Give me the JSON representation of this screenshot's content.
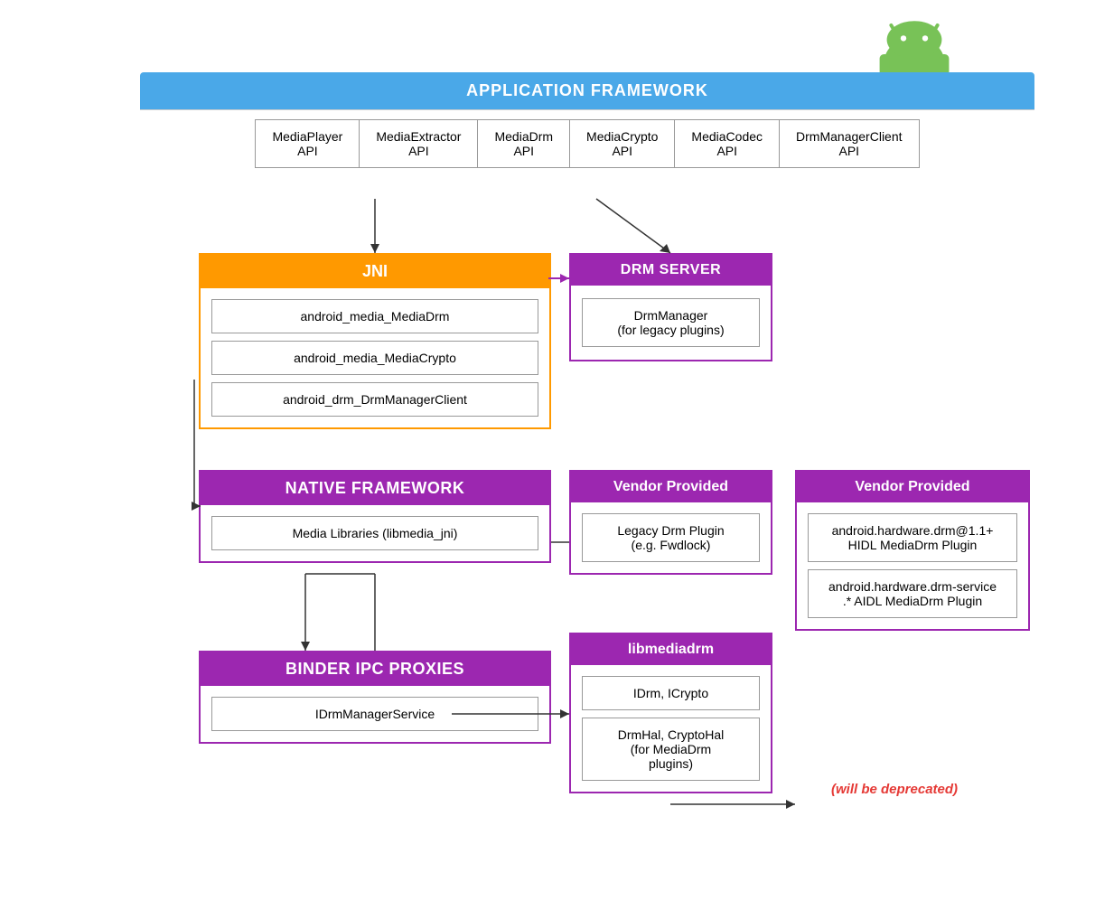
{
  "android_logo": {
    "alt": "Android Logo"
  },
  "app_framework": {
    "title": "APPLICATION FRAMEWORK",
    "apis": [
      "MediaPlayer\nAPI",
      "MediaExtractor\nAPI",
      "MediaDrm\nAPI",
      "MediaCrypto\nAPI",
      "MediaCodec\nAPI",
      "DrmManagerClient\nAPI"
    ]
  },
  "jni": {
    "title": "JNI",
    "items": [
      "android_media_MediaDrm",
      "android_media_MediaCrypto",
      "android_drm_DrmManagerClient"
    ]
  },
  "drm_server": {
    "title": "DRM SERVER",
    "item": "DrmManager\n(for legacy plugins)"
  },
  "native_framework": {
    "title": "NATIVE FRAMEWORK",
    "item": "Media Libraries (libmedia_jni)"
  },
  "vendor_left": {
    "title": "Vendor Provided",
    "item": "Legacy Drm Plugin\n(e.g. Fwdlock)"
  },
  "vendor_right": {
    "title": "Vendor Provided",
    "items": [
      "android.hardware.drm@1.1+\nHIDL MediaDrm Plugin",
      "android.hardware.drm-service\n.* AIDL MediaDrm Plugin"
    ]
  },
  "binder": {
    "title": "BINDER IPC PROXIES",
    "item": "IDrmManagerService"
  },
  "libmediadrm": {
    "title": "libmediadrm",
    "items": [
      "IDrm, ICrypto",
      "DrmHal, CryptoHal\n(for MediaDrm\nplugins)"
    ]
  },
  "deprecated": "(will be deprecated)",
  "colors": {
    "blue": "#4AA8E8",
    "orange": "#f90",
    "purple": "#9c27b0",
    "red": "#e53935",
    "android_green": "#78C257"
  }
}
